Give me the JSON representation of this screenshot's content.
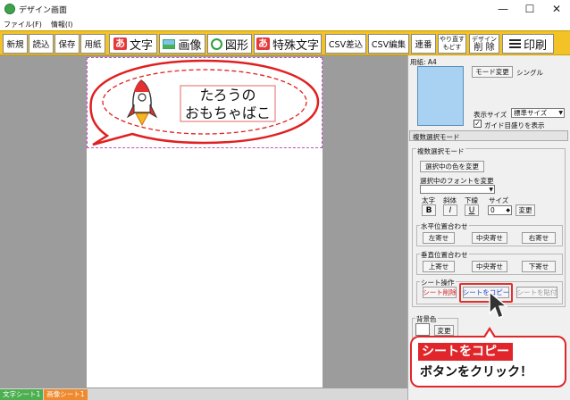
{
  "window": {
    "title": "デザイン画面",
    "minimize": "—",
    "maximize": "☐",
    "close": "✕"
  },
  "menu": [
    "ファイル(F)",
    "情報(I)"
  ],
  "toolbar": {
    "new": "新規",
    "open": "読込",
    "save": "保存",
    "paper": "用紙",
    "text": "文字",
    "text_icon": "あ",
    "image": "画像",
    "shape": "図形",
    "special_text": "特殊文字",
    "special_icon": "あ",
    "csv_import": "CSV差込",
    "csv_edit": "CSV編集",
    "serial": "連番",
    "redo_top": "やり直す",
    "redo_bottom": "もどす",
    "delete_top": "デザイン",
    "delete_bottom": "削 除",
    "print": "印刷",
    "accent": "#f2c227"
  },
  "canvas": {
    "label_text": "たろうの\nおもちゃばこ",
    "bubble_color": "#e02020",
    "rocket_icon": "rocket-icon"
  },
  "right_panel": {
    "paper_label": "用紙: A4",
    "mode_button": "モード変更",
    "mode_value": "シングル",
    "display_size_label": "表示サイズ",
    "display_size_value": "標準サイズ",
    "guide_label": "ガイド目盛りを表示",
    "guide_checked": true,
    "multi_select_header": "複数選択モード",
    "multi_select_group": "複数選択モード",
    "select_color_button": "選択中の色を変更",
    "select_font_label": "選択中のフォントを変更",
    "bold_label": "太字",
    "italic_label": "斜体",
    "underline_label": "下線",
    "size_label": "サイズ",
    "bold_btn": "B",
    "italic_btn": "I",
    "underline_btn": "U",
    "size_value": "0",
    "apply_button": "変更",
    "h_align_label": "水平位置合わせ",
    "left_align": "左寄せ",
    "h_center": "中央寄せ",
    "right_align": "右寄せ",
    "v_align_label": "垂直位置合わせ",
    "top_align": "上寄せ",
    "v_center": "中央寄せ",
    "bottom_align": "下寄せ",
    "sheet_ops_label": "シート操作",
    "sheet_delete": "シート削除",
    "sheet_copy": "シートをコピー",
    "sheet_paste": "シートを貼付",
    "bg_label": "背景色",
    "bg_change": "変更"
  },
  "sheet_tabs": [
    {
      "label": "文字シート1",
      "color": "#4caf50"
    },
    {
      "label": "画像シート1",
      "color": "#ef8a2e"
    }
  ],
  "callout": {
    "line1": "シートをコピー",
    "line2": "ボタンをクリック！"
  }
}
